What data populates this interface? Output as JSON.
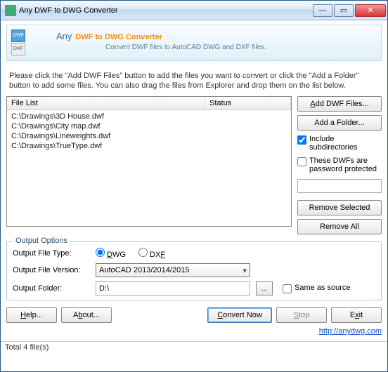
{
  "window": {
    "title": "Any DWF to DWG Converter"
  },
  "banner": {
    "any": "Any",
    "title": "DWF to DWG Converter",
    "subtitle": "Convert DWF files to AutoCAD DWG and DXF files."
  },
  "instructions": "Please click the \"Add DWF Files\" button to add the files you want to convert or click the \"Add a Folder\" button to add some files. You can also drag the files from Explorer and drop them on the list below.",
  "filelist": {
    "cols": {
      "file": "File List",
      "status": "Status"
    },
    "rows": [
      "C:\\Drawings\\3D House.dwf",
      "C:\\Drawings\\City map.dwf",
      "C:\\Drawings\\Lineweights.dwf",
      "C:\\Drawings\\TrueType.dwf"
    ]
  },
  "side": {
    "addFiles": "Add DWF Files...",
    "addFolder": "Add a Folder...",
    "includeSub": "Include subdirectories",
    "pwProtected": "These DWFs are password protected",
    "removeSelected": "Remove Selected",
    "removeAll": "Remove All"
  },
  "output": {
    "legend": "Output Options",
    "fileTypeLabel": "Output File Type:",
    "dwg": "DWG",
    "dxf": "DXF",
    "fileVersionLabel": "Output File Version:",
    "version": "AutoCAD 2013/2014/2015",
    "folderLabel": "Output Folder:",
    "folder": "D:\\",
    "browse": "...",
    "sameAsSource": "Same as source"
  },
  "bottom": {
    "help": "Help...",
    "about": "About...",
    "convert": "Convert Now",
    "stop": "Stop",
    "exit": "Exit"
  },
  "link": {
    "url": "http://anydwg.com"
  },
  "status": "Total 4 file(s)"
}
